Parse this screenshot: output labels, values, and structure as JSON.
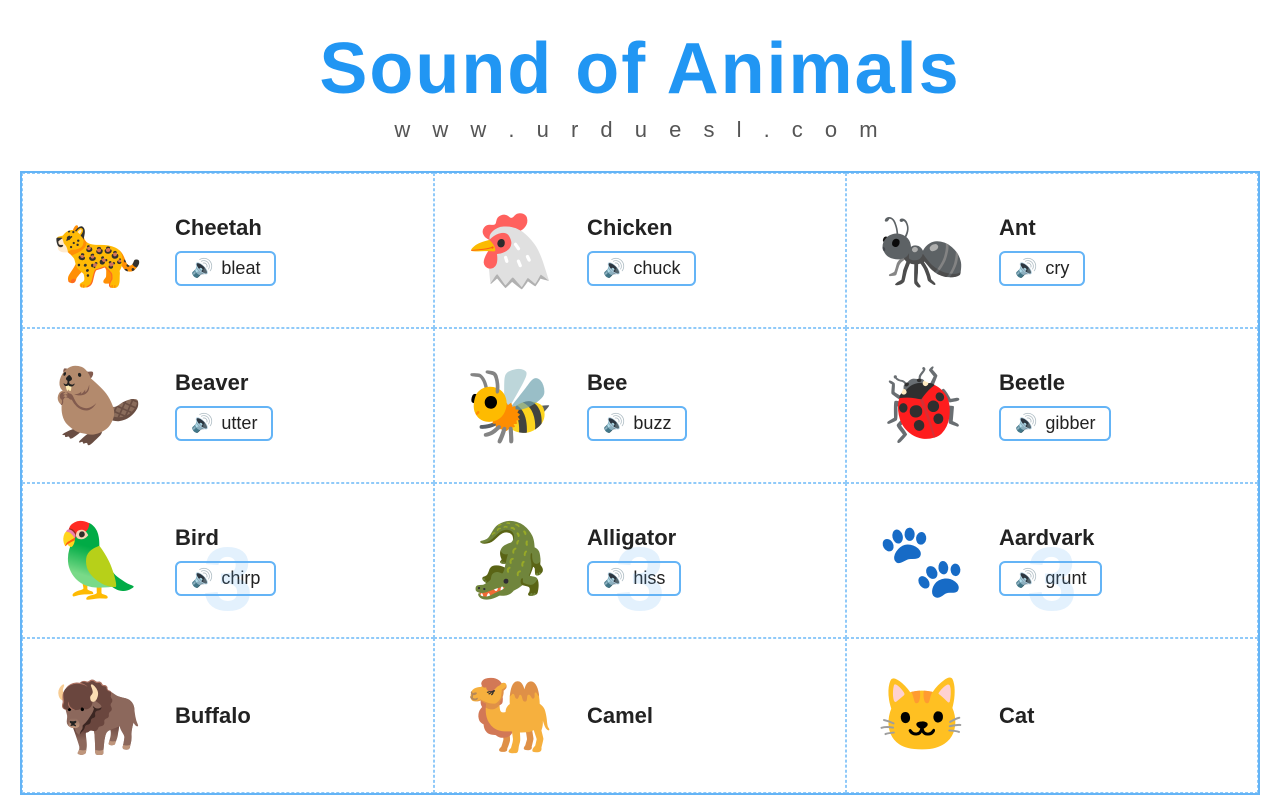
{
  "header": {
    "title": "Sound of Animals",
    "subtitle": "w w w . u r d u e s l . c o m"
  },
  "animals": [
    {
      "id": "cheetah",
      "name": "Cheetah",
      "sound": "bleat",
      "emoji": "🐆",
      "row": 1
    },
    {
      "id": "chicken",
      "name": "Chicken",
      "sound": "chuck",
      "emoji": "🐔",
      "row": 1
    },
    {
      "id": "ant",
      "name": "Ant",
      "sound": "cry",
      "emoji": "🐜",
      "row": 1
    },
    {
      "id": "beaver",
      "name": "Beaver",
      "sound": "utter",
      "emoji": "🦫",
      "row": 2
    },
    {
      "id": "bee",
      "name": "Bee",
      "sound": "buzz",
      "emoji": "🐝",
      "row": 2
    },
    {
      "id": "beetle",
      "name": "Beetle",
      "sound": "gibber",
      "emoji": "🐞",
      "row": 2
    },
    {
      "id": "bird",
      "name": "Bird",
      "sound": "chirp",
      "emoji": "🦜",
      "row": 3
    },
    {
      "id": "alligator",
      "name": "Alligator",
      "sound": "hiss",
      "emoji": "🐊",
      "row": 3
    },
    {
      "id": "aardvark",
      "name": "Aardvark",
      "sound": "grunt",
      "emoji": "🐾",
      "row": 3
    },
    {
      "id": "buffalo",
      "name": "Buffalo",
      "sound": "",
      "emoji": "🦬",
      "row": 4
    },
    {
      "id": "camel",
      "name": "Camel",
      "sound": "",
      "emoji": "🐫",
      "row": 4
    },
    {
      "id": "cat",
      "name": "Cat",
      "sound": "",
      "emoji": "🐱",
      "row": 4
    }
  ],
  "sound_icon": "🔊"
}
